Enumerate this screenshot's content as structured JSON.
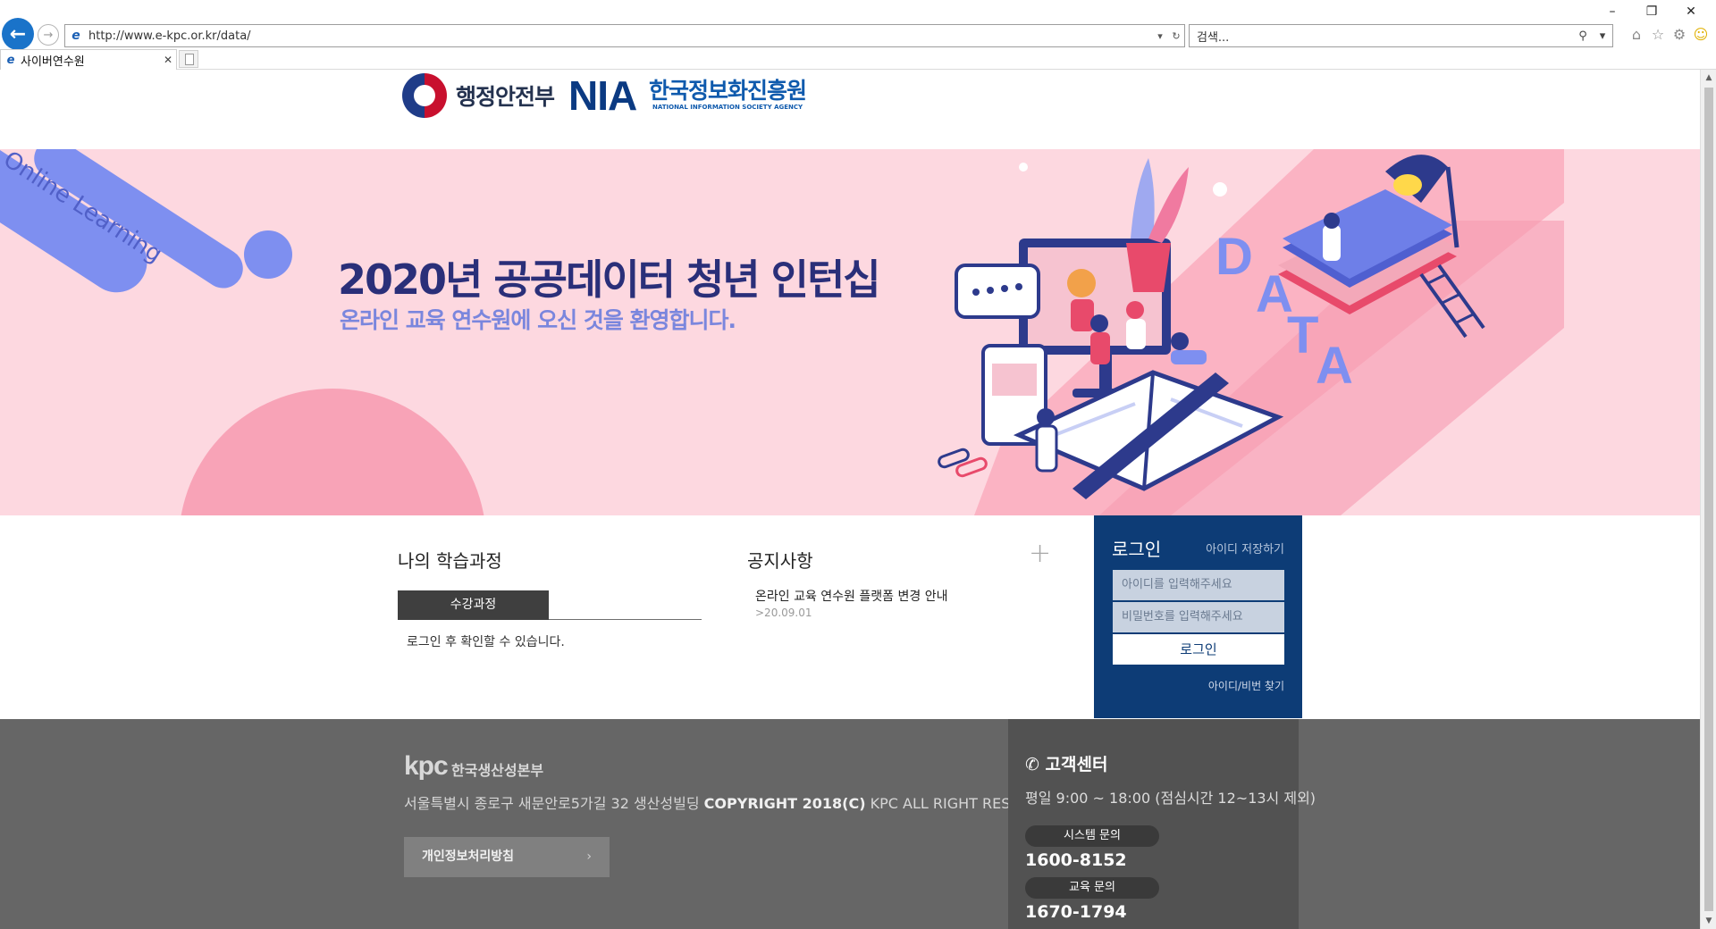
{
  "browser": {
    "url": "http://www.e-kpc.or.kr/data/",
    "search_placeholder": "검색...",
    "tab_title": "사이버연수원"
  },
  "header": {
    "ministry_name": "행정안전부",
    "agency_mark": "NIA",
    "agency_name_kr": "한국정보화진흥원",
    "agency_name_en": "NATIONAL INFORMATION SOCIETY AGENCY"
  },
  "banner": {
    "title": "2020년 공공데이터 청년 인턴십",
    "subtitle": "온라인 교육 연수원에 오신 것을 환영합니다.",
    "stripe_text": "Online Learning",
    "illustration_text": "DATA"
  },
  "my_course": {
    "title": "나의 학습과정",
    "tab_label": "수강과정",
    "message": "로그인 후 확인할 수 있습니다."
  },
  "notice": {
    "title": "공지사항",
    "more_icon": "plus-icon",
    "items": [
      {
        "title": "온라인 교육 연수원 플랫폼 변경 안내",
        "date": ">20.09.01"
      }
    ]
  },
  "login": {
    "title": "로그인",
    "remember_label": "아이디 저장하기",
    "id_placeholder": "아이디를 입력해주세요",
    "pw_placeholder": "비밀번호를 입력해주세요",
    "button_label": "로그인",
    "find_label": "아이디/비번 찾기"
  },
  "footer": {
    "logo_text": "kpc",
    "org_name": "한국생산성본부",
    "address": "서울특별시 종로구 새문안로5가길 32 생산성빌딩",
    "copyright": "COPYRIGHT 2018(C)",
    "rights": "KPC ALL RIGHT RESERVED.",
    "privacy_label": "개인정보처리방침",
    "customer_center": {
      "title": "고객센터",
      "hours": "평일 9:00 ~ 18:00 (점심시간 12~13시 제외)",
      "system_label": "시스템 문의",
      "system_phone": "1600-8152",
      "edu_label": "교육 문의",
      "edu_phone": "1670-1794"
    }
  },
  "colors": {
    "banner_bg": "#fdd8e0",
    "login_bg": "#0d3c76",
    "footer_bg": "#666666",
    "title_navy": "#2a2f79"
  }
}
